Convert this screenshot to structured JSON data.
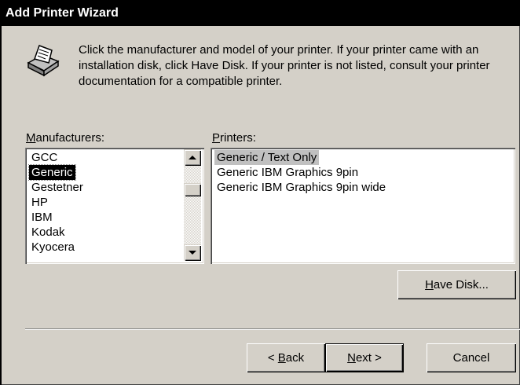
{
  "window": {
    "title": "Add Printer Wizard"
  },
  "intro": {
    "text": "Click the manufacturer and model of your printer.  If your printer came with an installation disk, click Have Disk.  If your printer is not listed, consult your printer documentation for a compatible printer."
  },
  "manufacturers": {
    "label_accel": "M",
    "label_rest": "anufacturers:",
    "items": [
      "GCC",
      "Generic",
      "Gestetner",
      "HP",
      "IBM",
      "Kodak",
      "Kyocera"
    ],
    "selected": "Generic"
  },
  "printers": {
    "label_accel": "P",
    "label_rest": "rinters:",
    "items": [
      "Generic / Text Only",
      "Generic IBM Graphics 9pin",
      "Generic IBM Graphics 9pin wide"
    ],
    "selected": "Generic / Text Only"
  },
  "buttons": {
    "have_disk_accel": "H",
    "have_disk_rest": "ave Disk...",
    "back_prefix": "< ",
    "back_accel": "B",
    "back_rest": "ack",
    "next_accel": "N",
    "next_rest": "ext >",
    "cancel": "Cancel"
  },
  "icons": {
    "printer": "printer-icon",
    "scroll_up": "arrow-up-icon",
    "scroll_down": "arrow-down-icon"
  },
  "colors": {
    "titlebar": "#000000",
    "face": "#d4d0c8",
    "selection": "#000000"
  }
}
